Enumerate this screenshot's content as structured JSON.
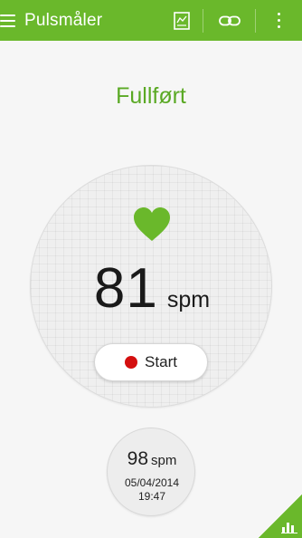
{
  "app": {
    "title": "Pulsmåler",
    "accent_color": "#6ab82b"
  },
  "toolbar": {
    "menu_icon": "hamburger-menu-icon",
    "actions": [
      {
        "icon": "report-icon"
      },
      {
        "icon": "link-icon"
      },
      {
        "icon": "more-vertical-icon"
      }
    ]
  },
  "measurement": {
    "status": "Fullført",
    "value": "81",
    "unit": "spm",
    "heart_icon": "heart-icon",
    "heart_color": "#6ab82b",
    "start_label": "Start",
    "start_dot_color": "#d40f0f"
  },
  "last_record": {
    "value": "98",
    "unit": "spm",
    "date": "05/04/2014",
    "time": "19:47"
  },
  "corner": {
    "icon": "bar-chart-icon"
  }
}
